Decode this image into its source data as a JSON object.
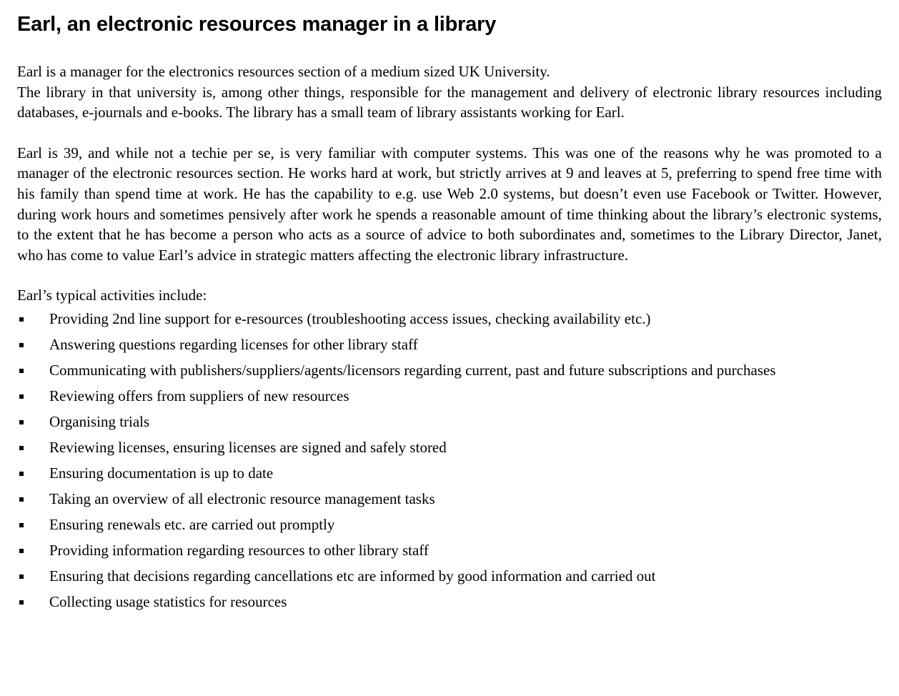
{
  "document": {
    "title": "Earl, an electronic resources manager in a library",
    "paragraph1": [
      "Earl is a manager for the electronics resources section of a medium sized UK University.",
      "The library in that university is, among other things, responsible for the management and delivery of electronic library resources including databases, e-journals and e-books. The library has a small team of library assistants working for Earl."
    ],
    "paragraph2": "Earl is 39, and while not a techie per se, is very familiar with computer systems. This was one of the reasons why he was promoted to a manager of the electronic resources section. He works hard at work, but strictly arrives at 9 and leaves at 5, preferring to spend free time with his family than spend time at work. He has the capability to e.g. use Web 2.0 systems, but doesn’t even use Facebook or Twitter. However, during work hours and sometimes pensively after work he spends a reasonable amount of time thinking about the library’s electronic systems, to the extent that he has become a person who acts as a source of advice to both subordinates and, sometimes to the Library Director, Janet, who has come to value Earl’s advice in strategic matters affecting the electronic library infrastructure.",
    "activities_intro": "Earl’s typical activities include:",
    "activities": [
      "Providing 2nd line support for e-resources (troubleshooting access issues, checking availability etc.)",
      "Answering questions regarding licenses for other library staff",
      "Communicating with publishers/suppliers/agents/licensors regarding current, past and future subscriptions and purchases",
      "Reviewing offers from suppliers of new resources",
      "Organising trials",
      "Reviewing licenses, ensuring licenses are signed and safely stored",
      "Ensuring documentation is up to date",
      "Taking an overview of all electronic resource management tasks",
      "Ensuring renewals etc. are carried out promptly",
      "Providing information regarding resources to other library staff",
      "Ensuring that decisions regarding cancellations etc are informed by good information and carried out",
      "Collecting usage statistics for resources"
    ]
  }
}
